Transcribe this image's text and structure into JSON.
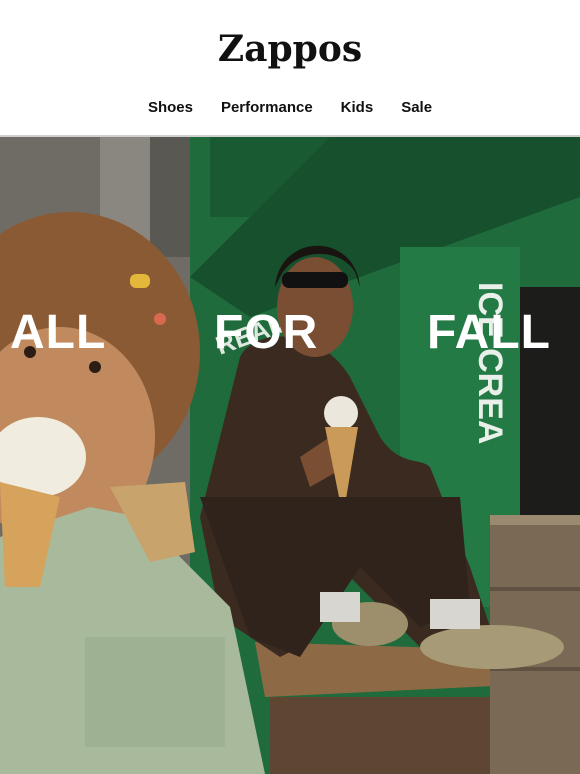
{
  "brand": {
    "name": "Zappos"
  },
  "nav": {
    "items": [
      "Shoes",
      "Performance",
      "Kids",
      "Sale"
    ]
  },
  "hero": {
    "headline_words": [
      "ALL",
      "FOR",
      "FALL"
    ],
    "storefront_sign_text": "ICE CREA",
    "awning_text": "REAM"
  },
  "colors": {
    "storefront_green": "#1f6b3c",
    "headline": "#ffffff",
    "background": "#ffffff"
  }
}
